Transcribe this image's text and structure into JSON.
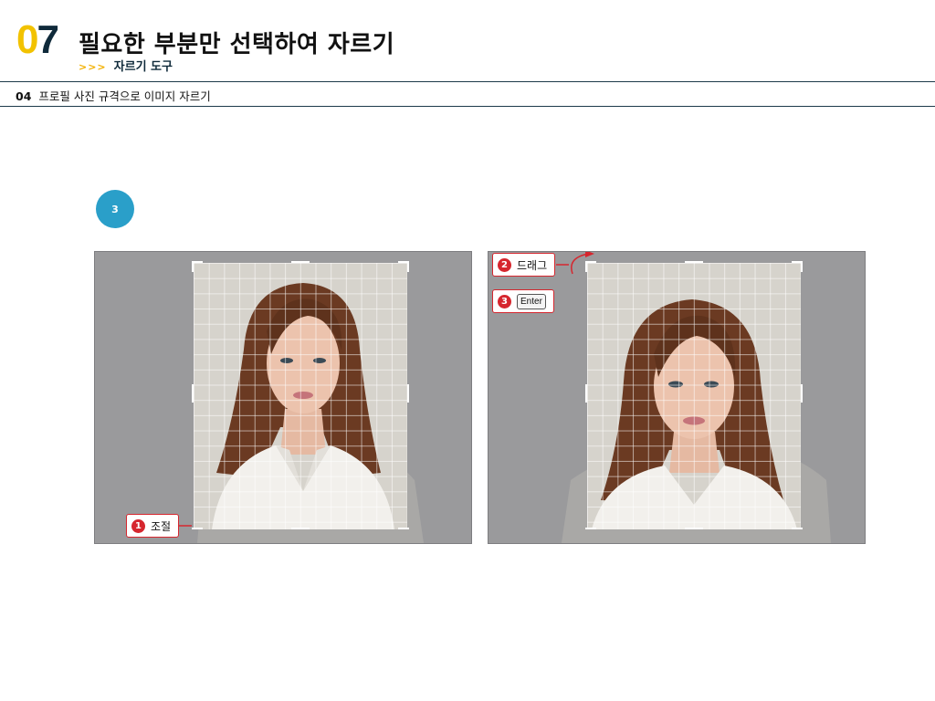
{
  "header": {
    "chapter_digit_0": "0",
    "chapter_digit_7": "7",
    "title": "필요한 부분만 선택하여 자르기",
    "subtitle_arrows": ">>>",
    "subtitle": "자르기 도구"
  },
  "section": {
    "number": "04",
    "title": "프로필 사진 규격으로 이미지 자르기"
  },
  "step": {
    "number": "3"
  },
  "left_panel": {
    "callout_number": "1",
    "callout_label": "조절"
  },
  "right_panel": {
    "callout_drag_number": "2",
    "callout_drag_label": "드래그",
    "callout_enter_number": "3",
    "callout_enter_key": "Enter"
  },
  "colors": {
    "accent_yellow": "#f2c200",
    "navy": "#0f2a3a",
    "step_blue": "#2a9fc9",
    "callout_red": "#d6262e",
    "panel_gray": "#9a9a9c"
  }
}
